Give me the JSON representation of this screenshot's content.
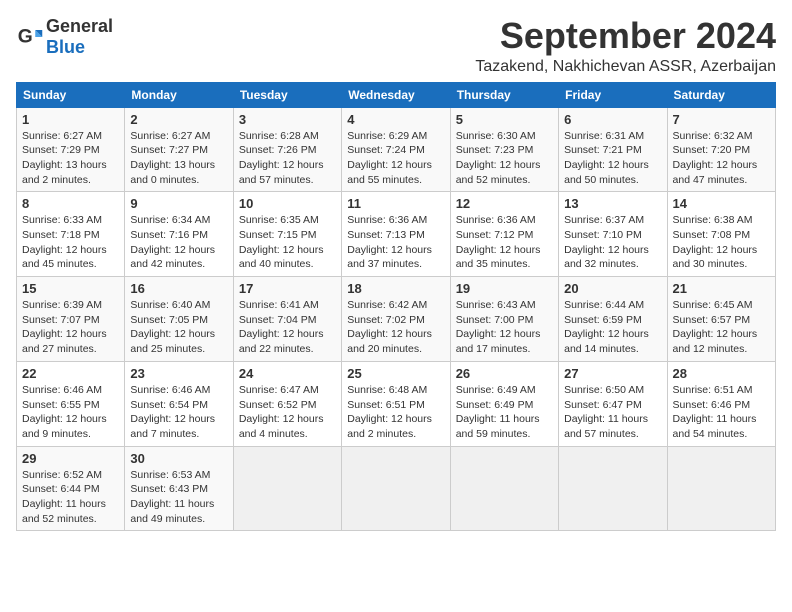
{
  "logo": {
    "general": "General",
    "blue": "Blue"
  },
  "header": {
    "month": "September 2024",
    "location": "Tazakend, Nakhichevan ASSR, Azerbaijan"
  },
  "weekdays": [
    "Sunday",
    "Monday",
    "Tuesday",
    "Wednesday",
    "Thursday",
    "Friday",
    "Saturday"
  ],
  "weeks": [
    [
      {
        "day": "1",
        "info": "Sunrise: 6:27 AM\nSunset: 7:29 PM\nDaylight: 13 hours\nand 2 minutes."
      },
      {
        "day": "2",
        "info": "Sunrise: 6:27 AM\nSunset: 7:27 PM\nDaylight: 13 hours\nand 0 minutes."
      },
      {
        "day": "3",
        "info": "Sunrise: 6:28 AM\nSunset: 7:26 PM\nDaylight: 12 hours\nand 57 minutes."
      },
      {
        "day": "4",
        "info": "Sunrise: 6:29 AM\nSunset: 7:24 PM\nDaylight: 12 hours\nand 55 minutes."
      },
      {
        "day": "5",
        "info": "Sunrise: 6:30 AM\nSunset: 7:23 PM\nDaylight: 12 hours\nand 52 minutes."
      },
      {
        "day": "6",
        "info": "Sunrise: 6:31 AM\nSunset: 7:21 PM\nDaylight: 12 hours\nand 50 minutes."
      },
      {
        "day": "7",
        "info": "Sunrise: 6:32 AM\nSunset: 7:20 PM\nDaylight: 12 hours\nand 47 minutes."
      }
    ],
    [
      {
        "day": "8",
        "info": "Sunrise: 6:33 AM\nSunset: 7:18 PM\nDaylight: 12 hours\nand 45 minutes."
      },
      {
        "day": "9",
        "info": "Sunrise: 6:34 AM\nSunset: 7:16 PM\nDaylight: 12 hours\nand 42 minutes."
      },
      {
        "day": "10",
        "info": "Sunrise: 6:35 AM\nSunset: 7:15 PM\nDaylight: 12 hours\nand 40 minutes."
      },
      {
        "day": "11",
        "info": "Sunrise: 6:36 AM\nSunset: 7:13 PM\nDaylight: 12 hours\nand 37 minutes."
      },
      {
        "day": "12",
        "info": "Sunrise: 6:36 AM\nSunset: 7:12 PM\nDaylight: 12 hours\nand 35 minutes."
      },
      {
        "day": "13",
        "info": "Sunrise: 6:37 AM\nSunset: 7:10 PM\nDaylight: 12 hours\nand 32 minutes."
      },
      {
        "day": "14",
        "info": "Sunrise: 6:38 AM\nSunset: 7:08 PM\nDaylight: 12 hours\nand 30 minutes."
      }
    ],
    [
      {
        "day": "15",
        "info": "Sunrise: 6:39 AM\nSunset: 7:07 PM\nDaylight: 12 hours\nand 27 minutes."
      },
      {
        "day": "16",
        "info": "Sunrise: 6:40 AM\nSunset: 7:05 PM\nDaylight: 12 hours\nand 25 minutes."
      },
      {
        "day": "17",
        "info": "Sunrise: 6:41 AM\nSunset: 7:04 PM\nDaylight: 12 hours\nand 22 minutes."
      },
      {
        "day": "18",
        "info": "Sunrise: 6:42 AM\nSunset: 7:02 PM\nDaylight: 12 hours\nand 20 minutes."
      },
      {
        "day": "19",
        "info": "Sunrise: 6:43 AM\nSunset: 7:00 PM\nDaylight: 12 hours\nand 17 minutes."
      },
      {
        "day": "20",
        "info": "Sunrise: 6:44 AM\nSunset: 6:59 PM\nDaylight: 12 hours\nand 14 minutes."
      },
      {
        "day": "21",
        "info": "Sunrise: 6:45 AM\nSunset: 6:57 PM\nDaylight: 12 hours\nand 12 minutes."
      }
    ],
    [
      {
        "day": "22",
        "info": "Sunrise: 6:46 AM\nSunset: 6:55 PM\nDaylight: 12 hours\nand 9 minutes."
      },
      {
        "day": "23",
        "info": "Sunrise: 6:46 AM\nSunset: 6:54 PM\nDaylight: 12 hours\nand 7 minutes."
      },
      {
        "day": "24",
        "info": "Sunrise: 6:47 AM\nSunset: 6:52 PM\nDaylight: 12 hours\nand 4 minutes."
      },
      {
        "day": "25",
        "info": "Sunrise: 6:48 AM\nSunset: 6:51 PM\nDaylight: 12 hours\nand 2 minutes."
      },
      {
        "day": "26",
        "info": "Sunrise: 6:49 AM\nSunset: 6:49 PM\nDaylight: 11 hours\nand 59 minutes."
      },
      {
        "day": "27",
        "info": "Sunrise: 6:50 AM\nSunset: 6:47 PM\nDaylight: 11 hours\nand 57 minutes."
      },
      {
        "day": "28",
        "info": "Sunrise: 6:51 AM\nSunset: 6:46 PM\nDaylight: 11 hours\nand 54 minutes."
      }
    ],
    [
      {
        "day": "29",
        "info": "Sunrise: 6:52 AM\nSunset: 6:44 PM\nDaylight: 11 hours\nand 52 minutes."
      },
      {
        "day": "30",
        "info": "Sunrise: 6:53 AM\nSunset: 6:43 PM\nDaylight: 11 hours\nand 49 minutes."
      },
      {
        "day": "",
        "info": ""
      },
      {
        "day": "",
        "info": ""
      },
      {
        "day": "",
        "info": ""
      },
      {
        "day": "",
        "info": ""
      },
      {
        "day": "",
        "info": ""
      }
    ]
  ]
}
